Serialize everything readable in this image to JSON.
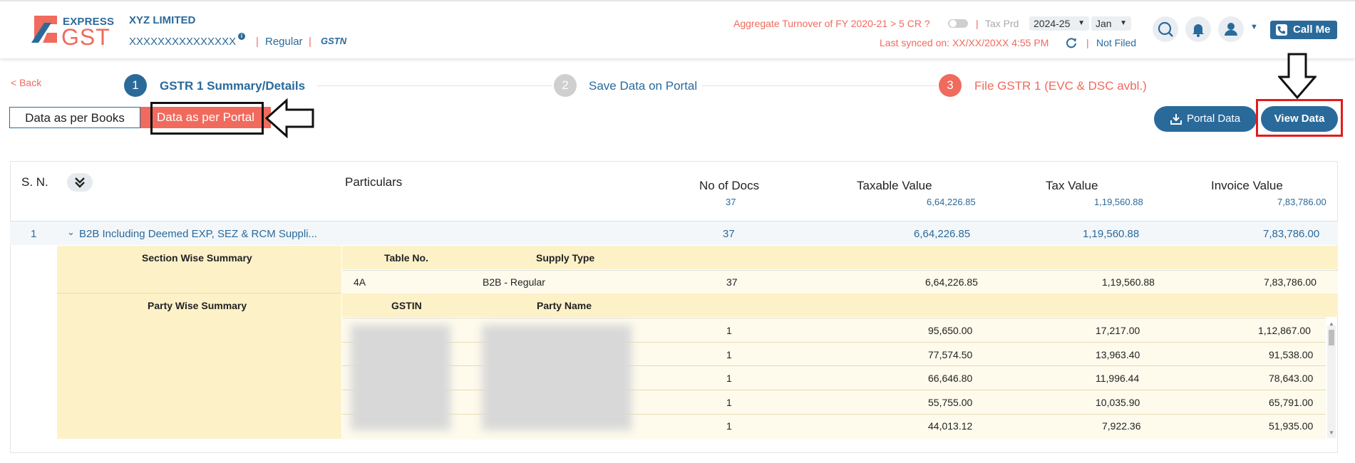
{
  "brand": {
    "line1": "EXPRESS",
    "line2": "GST"
  },
  "company": {
    "name": "XYZ LIMITED",
    "gstin": "XXXXXXXXXXXXXXX",
    "info_badge": "i",
    "sep": "|",
    "type": "Regular",
    "gstn_badge": "GSTN"
  },
  "header": {
    "turnover_text": "Aggregate Turnover of FY 2020-21 > 5 CR ?",
    "sep": "|",
    "tax_period_label": "Tax Prd",
    "year": "2024-25",
    "month": "Jan",
    "synced": "Last synced on: XX/XX/20XX 4:55 PM",
    "status": "Not Filed",
    "call_me": "Call Me"
  },
  "nav": {
    "back": "< Back"
  },
  "steps": [
    {
      "num": "1",
      "label": "GSTR 1 Summary/Details"
    },
    {
      "num": "2",
      "label": "Save Data on Portal"
    },
    {
      "num": "3",
      "label": "File GSTR 1 (EVC & DSC avbl.)"
    }
  ],
  "tabs": {
    "books": "Data as per Books",
    "portal": "Data as per Portal"
  },
  "actions": {
    "portal_data": "Portal Data",
    "view_data": "View Data"
  },
  "table": {
    "headers": {
      "sn": "S. N.",
      "particulars": "Particulars",
      "docs": "No of Docs",
      "taxable": "Taxable Value",
      "tax": "Tax Value",
      "invoice": "Invoice Value"
    },
    "totals": {
      "docs": "37",
      "taxable": "6,64,226.85",
      "tax": "1,19,560.88",
      "invoice": "7,83,786.00"
    },
    "row1": {
      "sn": "1",
      "label": "B2B Including Deemed EXP, SEZ & RCM Suppli...",
      "docs": "37",
      "taxable": "6,64,226.85",
      "tax": "1,19,560.88",
      "invoice": "7,83,786.00"
    },
    "section": {
      "title": "Section Wise Summary",
      "col_table": "Table No.",
      "col_supply": "Supply Type",
      "row": {
        "table_no": "4A",
        "supply": "B2B - Regular",
        "docs": "37",
        "taxable": "6,64,226.85",
        "tax": "1,19,560.88",
        "invoice": "7,83,786.00"
      }
    },
    "party": {
      "title": "Party Wise Summary",
      "col_gstin": "GSTIN",
      "col_name": "Party Name",
      "rows": [
        {
          "docs": "1",
          "taxable": "95,650.00",
          "tax": "17,217.00",
          "invoice": "1,12,867.00"
        },
        {
          "docs": "1",
          "taxable": "77,574.50",
          "tax": "13,963.40",
          "invoice": "91,538.00"
        },
        {
          "docs": "1",
          "taxable": "66,646.80",
          "tax": "11,996.44",
          "invoice": "78,643.00"
        },
        {
          "docs": "1",
          "taxable": "55,755.00",
          "tax": "10,035.90",
          "invoice": "65,791.00"
        },
        {
          "docs": "1",
          "taxable": "44,013.12",
          "tax": "7,922.36",
          "invoice": "51,935.00"
        }
      ]
    }
  },
  "colors": {
    "brand_blue": "#2a6a9b",
    "accent": "#f06a5d",
    "highlight_red": "#e21c1c"
  }
}
